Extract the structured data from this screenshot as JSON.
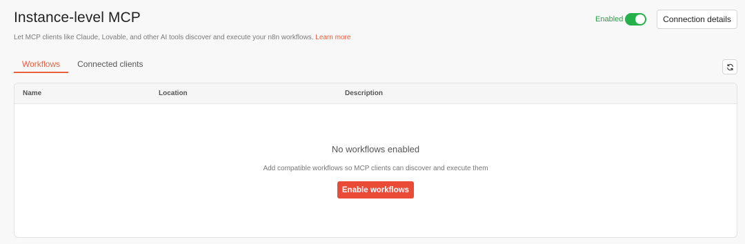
{
  "header": {
    "title": "Instance-level MCP",
    "subtitle": "Let MCP clients like Claude, Lovable, and other AI tools discover and execute your n8n workflows.",
    "learn_more": "Learn more",
    "enabled_label": "Enabled",
    "toggle_on": true,
    "connection_button": "Connection details"
  },
  "tabs": [
    {
      "label": "Workflows",
      "active": true
    },
    {
      "label": "Connected clients",
      "active": false
    }
  ],
  "table": {
    "columns": [
      "Name",
      "Location",
      "Description"
    ],
    "empty_title": "No workflows enabled",
    "empty_description": "Add compatible workflows so MCP clients can discover and execute them",
    "enable_button": "Enable workflows"
  },
  "colors": {
    "accent": "#e8613c",
    "primary_button": "#ea4b36",
    "toggle_on": "#26b04a",
    "enabled_text": "#2f9d4c"
  },
  "icons": {
    "refresh": "refresh-icon"
  }
}
